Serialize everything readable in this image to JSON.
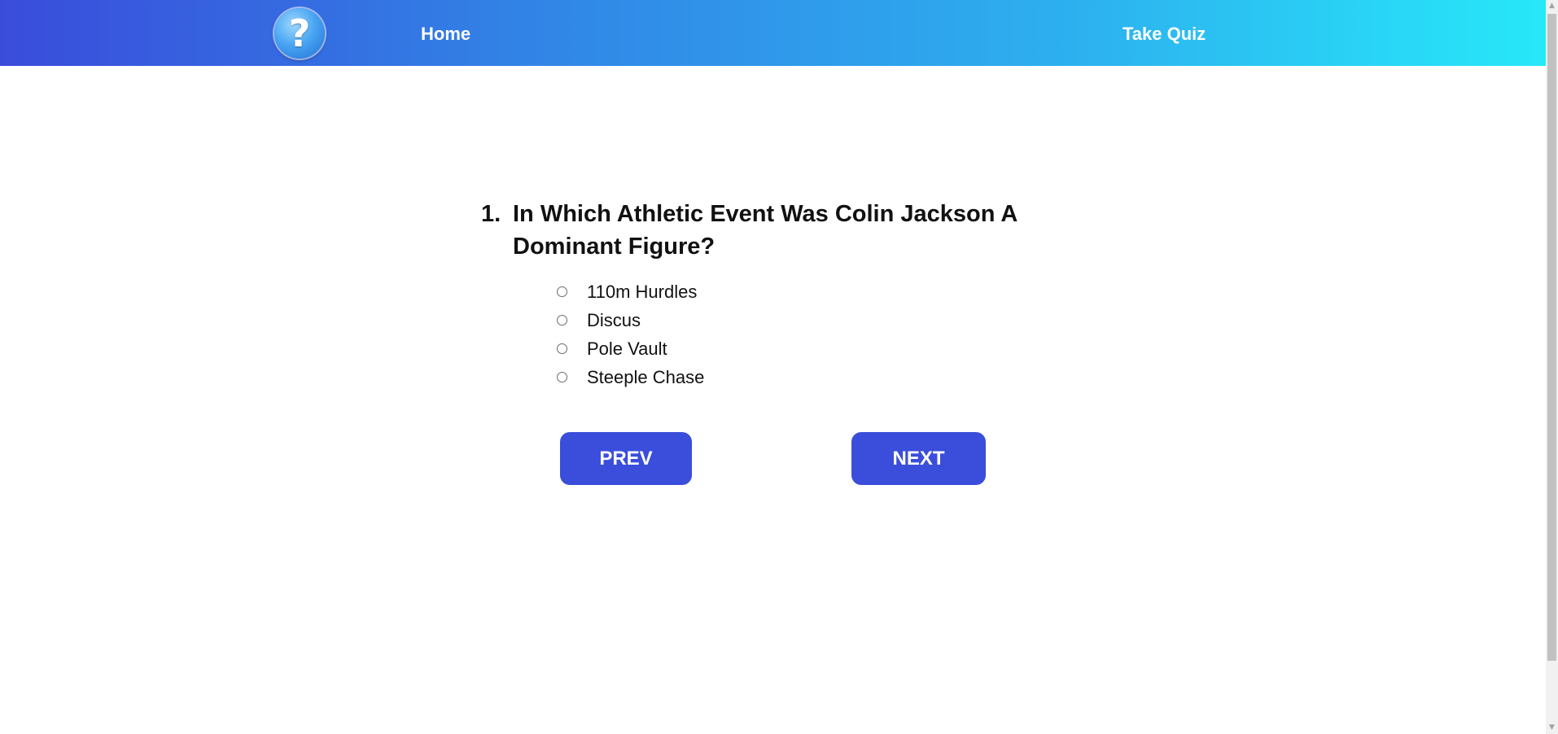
{
  "nav": {
    "logo_glyph": "?",
    "home_label": "Home",
    "quiz_label": "Take Quiz"
  },
  "question": {
    "number": "1.",
    "text": "In Which Athletic Event Was Colin Jackson A Dominant Figure?",
    "options": [
      {
        "label": "110m Hurdles",
        "selected": false
      },
      {
        "label": "Discus",
        "selected": false
      },
      {
        "label": "Pole Vault",
        "selected": false
      },
      {
        "label": "Steeple Chase",
        "selected": false
      }
    ]
  },
  "buttons": {
    "prev_label": "PREV",
    "next_label": "NEXT"
  },
  "colors": {
    "nav_gradient_start": "#3a4cdb",
    "nav_gradient_end": "#27e8f9",
    "button_bg": "#3a4edb",
    "text": "#111111"
  },
  "icons": {
    "logo": "question-mark-icon",
    "scroll_up": "scroll-up-arrow-icon",
    "scroll_down": "scroll-down-arrow-icon"
  }
}
